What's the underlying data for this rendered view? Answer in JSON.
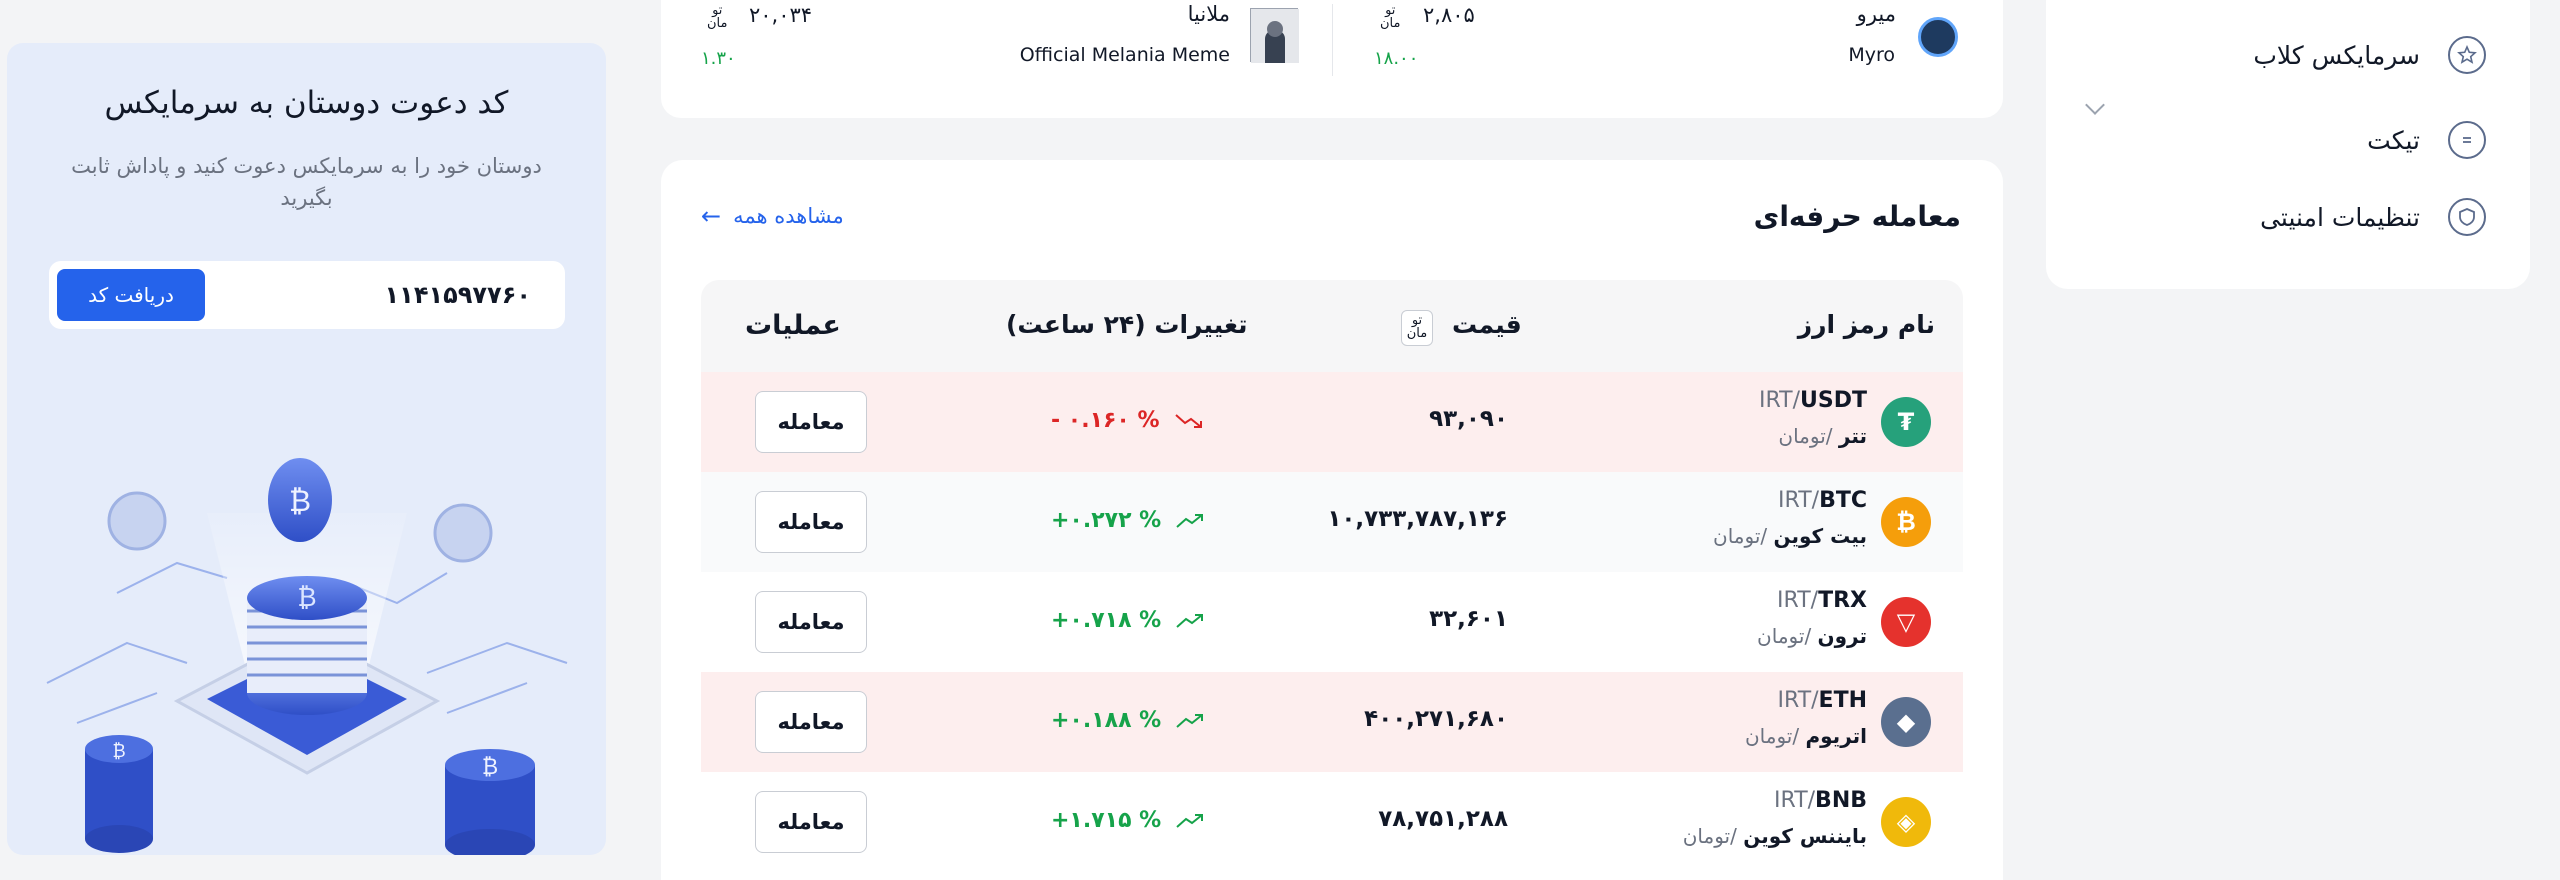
{
  "menu": {
    "items": [
      {
        "label": "سرمایکس کلاب",
        "icon": "star-icon"
      },
      {
        "label": "تیکت",
        "icon": "ticket-icon"
      },
      {
        "label": "تنظیمات امنیتی",
        "icon": "shield-icon"
      }
    ]
  },
  "ticker": {
    "right": {
      "abbr": "میرو",
      "name": "Myro",
      "price": "۲,۸۰۵",
      "change": "۱۸.۰۰"
    },
    "left": {
      "abbr": "ملانیا",
      "name": "Official Melania Meme",
      "price": "۲۰,۰۳۴",
      "change": "۱.۳۰"
    },
    "toman_top": "تو",
    "toman_bottom": "مان"
  },
  "trade": {
    "title": "معامله حرفه‌ای",
    "view_all": "مشاهده همه",
    "headers": {
      "name": "نام رمز ارز",
      "price": "قیمت",
      "change": "تغییرات (۲۴ ساعت)",
      "ops": "عملیات"
    },
    "rows": [
      {
        "pair": "USDT",
        "quote": "IRT/",
        "fa": "تتر",
        "unit": "/تومان",
        "price": "۹۳,۰۹۰",
        "change": "- ۰.۱۶۰ %",
        "dir": "neg",
        "btn": "معامله",
        "color": "#26a17b",
        "glyph": "₮"
      },
      {
        "pair": "BTC",
        "quote": "IRT/",
        "fa": "بیت کوین",
        "unit": "/تومان",
        "price": "۱۰,۷۳۳,۷۸۷,۱۳۶",
        "change": "+۰.۲۷۲ %",
        "dir": "pos",
        "btn": "معامله",
        "color": "#f59e0b",
        "glyph": "₿"
      },
      {
        "pair": "TRX",
        "quote": "IRT/",
        "fa": "ترون",
        "unit": "/تومان",
        "price": "۳۲,۶۰۱",
        "change": "+۰.۷۱۸ %",
        "dir": "pos",
        "btn": "معامله",
        "color": "#e5322d",
        "glyph": "▽"
      },
      {
        "pair": "ETH",
        "quote": "IRT/",
        "fa": "اتریوم",
        "unit": "/تومان",
        "price": "۴۰۰,۲۷۱,۶۸۰",
        "change": "+۰.۱۸۸ %",
        "dir": "pos",
        "btn": "معامله",
        "color": "#5a6f8f",
        "glyph": "◆"
      },
      {
        "pair": "BNB",
        "quote": "IRT/",
        "fa": "بایننس کوین",
        "unit": "/تومان",
        "price": "۷۸,۷۵۱,۲۸۸",
        "change": "+۱.۷۱۵ %",
        "dir": "pos",
        "btn": "معامله",
        "color": "#f0b90b",
        "glyph": "◈"
      }
    ]
  },
  "invite": {
    "title": "کد دعوت دوستان به سرمایکس",
    "desc": "دوستان خود را به سرمایکس دعوت کنید و پاداش ثابت بگیرید",
    "code": "۱۱۴۱۵۹۷۷۶۰",
    "button": "دریافت کد"
  },
  "colors": {
    "accent": "#2563eb",
    "positive": "#16a34a",
    "negative": "#dc2626"
  }
}
